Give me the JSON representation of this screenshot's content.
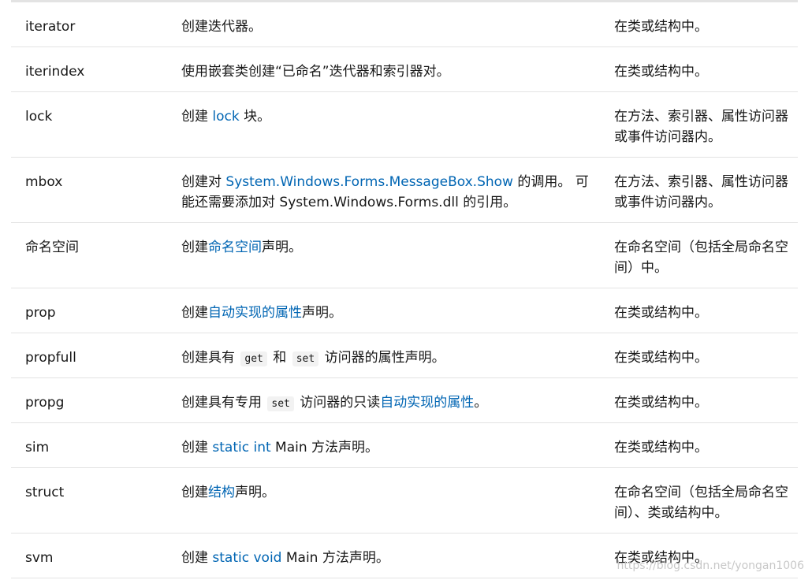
{
  "rows": [
    {
      "col1": "iterator",
      "col2_parts": [
        "创建迭代器。"
      ],
      "col3": "在类或结构中。"
    },
    {
      "col1": "iterindex",
      "col2_parts": [
        "使用嵌套类创建“已命名”迭代器和索引器对。"
      ],
      "col3": "在类或结构中。"
    },
    {
      "col1": "lock",
      "col2_parts": [
        "创建 ",
        "lock",
        " 块。"
      ],
      "col3": "在方法、索引器、属性访问器或事件访问器内。"
    },
    {
      "col1": "mbox",
      "col2_parts": [
        "创建对 ",
        "System.Windows.Forms.MessageBox.Show",
        " 的调用。 可能还需要添加对 System.Windows.Forms.dll 的引用。"
      ],
      "col3": "在方法、索引器、属性访问器或事件访问器内。"
    },
    {
      "col1": "命名空间",
      "col2_parts": [
        "创建",
        "命名空间",
        "声明。"
      ],
      "col3": "在命名空间（包括全局命名空间）中。"
    },
    {
      "col1": "prop",
      "col2_parts": [
        "创建",
        "自动实现的属性",
        "声明。"
      ],
      "col3": "在类或结构中。"
    },
    {
      "col1": "propfull",
      "col2_parts": [
        "创建具有 ",
        "get",
        " 和 ",
        "set",
        " 访问器的属性声明。"
      ],
      "col3": "在类或结构中。"
    },
    {
      "col1": "propg",
      "col2_parts": [
        "创建具有专用 ",
        "set",
        " 访问器的只读",
        "自动实现的属性",
        "。"
      ],
      "col3": "在类或结构中。"
    },
    {
      "col1": "sim",
      "col2_parts": [
        "创建 ",
        "static int",
        " Main 方法声明。"
      ],
      "col3": "在类或结构中。"
    },
    {
      "col1": "struct",
      "col2_parts": [
        "创建",
        "结构",
        "声明。"
      ],
      "col3": "在命名空间（包括全局命名空间）、类或结构中。"
    },
    {
      "col1": "svm",
      "col2_parts": [
        "创建 ",
        "static void",
        " Main 方法声明。"
      ],
      "col3": "在类或结构中。"
    }
  ],
  "watermark": "https://blog.csdn.net/yongan1006",
  "colors": {
    "link": "#0065b3",
    "divider": "#e3e3e3",
    "code_bg": "#f2f2f2"
  }
}
